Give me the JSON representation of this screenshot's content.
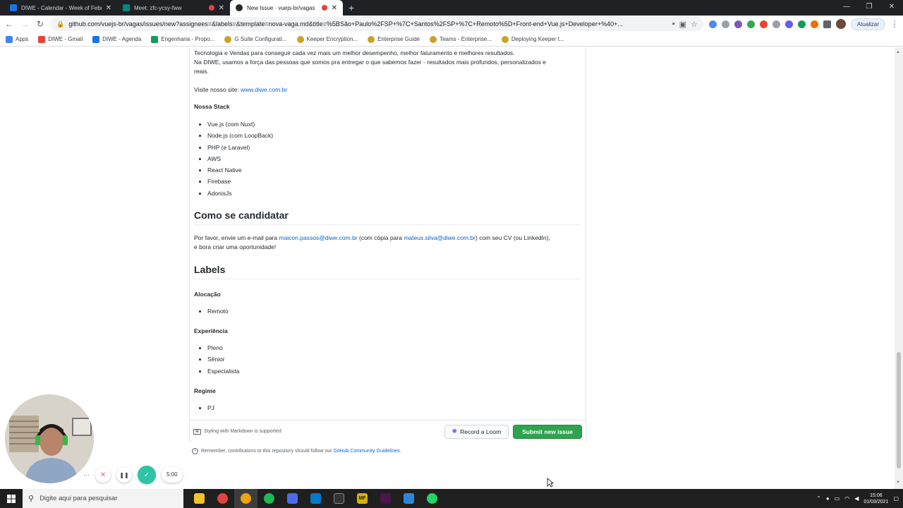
{
  "browser": {
    "tabs": [
      {
        "title": "DIWE - Calendar - Week of Febr",
        "favicon_color": "#1a73e8",
        "recording": false,
        "active": false
      },
      {
        "title": "Meet: zfc-ycsy-fww",
        "favicon_color": "#00897b",
        "recording": true,
        "active": false
      },
      {
        "title": "New Issue · vuejs-br/vagas",
        "favicon_color": "#24292e",
        "recording": true,
        "active": true
      }
    ],
    "new_tab": "+",
    "url": "github.com/vuejs-br/vagas/issues/new?assignees=&labels=&template=nova-vaga.md&title=%5BSão+Paulo%2FSP+%7C+Santos%2FSP+%7C+Remoto%5D+Front-end+Vue.js+Developer+%40+...",
    "update_label": "Atualizar",
    "bookmarks": [
      {
        "label": "Apps",
        "color": "#4285f4"
      },
      {
        "label": "DIWE - Gmail",
        "color": "#ea4335"
      },
      {
        "label": "DIWE - Agenda",
        "color": "#1a73e8"
      },
      {
        "label": "Engenharia - Propo...",
        "color": "#0f9d58"
      },
      {
        "label": "G Suite Configurati...",
        "color": "#c9a227"
      },
      {
        "label": "Keeper Encryption...",
        "color": "#c9a227"
      },
      {
        "label": "Enterprise Guide",
        "color": "#c9a227"
      },
      {
        "label": "Teams - Enterprise...",
        "color": "#c9a227"
      },
      {
        "label": "Deploying Keeper t...",
        "color": "#c9a227"
      }
    ]
  },
  "issue": {
    "intro_line1": "Tecnologia e Vendas para conseguir cada vez mais um melhor desempenho, melhor faturamento e melhores resultados.",
    "intro_line2": "Na DIWE, usamos a força das pessoas que somos pra entregar o que sabemos fazer - resultados mais profundos, personalizados e",
    "intro_line3": "reais.",
    "visit_label": "Visite nosso site: ",
    "visit_link": "www.diwe.com.br",
    "stack_heading": "Nossa Stack",
    "stack": [
      "Vue.js (com Nuxt)",
      "Node.js (com LoopBack)",
      "PHP (e Laravel)",
      "AWS",
      "React Native",
      "Firebase",
      "AdonisJs"
    ],
    "apply_heading": "Como se candidatar",
    "apply_text1": "Por favor, envie um e-mail para ",
    "apply_email1": "maicon.passos@diwe.com.br",
    "apply_text2": " (com cópia para ",
    "apply_email2": "mateus.silva@diwe.com.br",
    "apply_text3": ") com seu CV (ou LinkedIn),",
    "apply_line2": "e bora criar uma oportunidade!",
    "labels_heading": "Labels",
    "alocacao_heading": "Alocação",
    "alocacao": [
      "Remoto"
    ],
    "experiencia_heading": "Experiência",
    "experiencia": [
      "Pleno",
      "Sênior",
      "Especialista"
    ],
    "regime_heading": "Regime",
    "regime": [
      "PJ"
    ],
    "markdown_note": "Styling with Markdown is supported",
    "record_loom": "Record a Loom",
    "submit": "Submit new issue",
    "remember_text": "Remember, contributions to this repository should follow our ",
    "guidelines_link": "GitHub Community Guidelines",
    "remember_end": "."
  },
  "recorder": {
    "more": "···",
    "cancel": "✕",
    "pause": "❚❚",
    "done": "✓",
    "time": "5:00"
  },
  "taskbar": {
    "search_placeholder": "Digite aqui para pesquisar",
    "apps": [
      {
        "name": "explorer",
        "color": "#f3c12a",
        "label": ""
      },
      {
        "name": "chrome",
        "color": "#e0443e",
        "label": ""
      },
      {
        "name": "chrome-alt",
        "color": "#f0a30a",
        "label": ""
      },
      {
        "name": "spotify",
        "color": "#1db954",
        "label": ""
      },
      {
        "name": "tool",
        "color": "#4f6bed",
        "label": ""
      },
      {
        "name": "vscode",
        "color": "#007acc",
        "label": ""
      },
      {
        "name": "terminal",
        "color": "#333333",
        "label": ""
      },
      {
        "name": "mf",
        "color": "#d4b106",
        "label": "MF"
      },
      {
        "name": "slack",
        "color": "#4a154b",
        "label": ""
      },
      {
        "name": "notes",
        "color": "#2b88d8",
        "label": ""
      },
      {
        "name": "whatsapp",
        "color": "#25d366",
        "label": ""
      }
    ],
    "time": "15:06",
    "date": "01/03/2021"
  }
}
